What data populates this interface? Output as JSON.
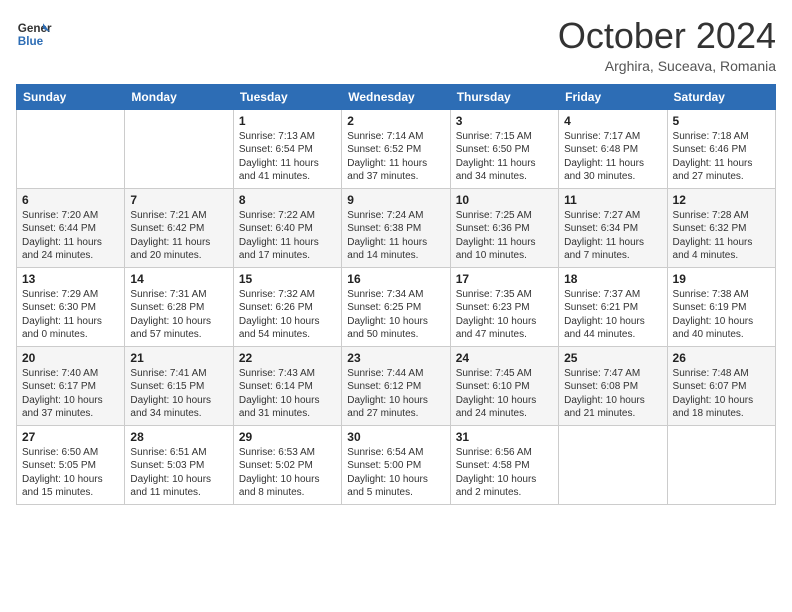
{
  "header": {
    "logo_line1": "General",
    "logo_line2": "Blue",
    "month": "October 2024",
    "location": "Arghira, Suceava, Romania"
  },
  "weekdays": [
    "Sunday",
    "Monday",
    "Tuesday",
    "Wednesday",
    "Thursday",
    "Friday",
    "Saturday"
  ],
  "weeks": [
    [
      {
        "day": "",
        "sunrise": "",
        "sunset": "",
        "daylight": ""
      },
      {
        "day": "",
        "sunrise": "",
        "sunset": "",
        "daylight": ""
      },
      {
        "day": "1",
        "sunrise": "Sunrise: 7:13 AM",
        "sunset": "Sunset: 6:54 PM",
        "daylight": "Daylight: 11 hours and 41 minutes."
      },
      {
        "day": "2",
        "sunrise": "Sunrise: 7:14 AM",
        "sunset": "Sunset: 6:52 PM",
        "daylight": "Daylight: 11 hours and 37 minutes."
      },
      {
        "day": "3",
        "sunrise": "Sunrise: 7:15 AM",
        "sunset": "Sunset: 6:50 PM",
        "daylight": "Daylight: 11 hours and 34 minutes."
      },
      {
        "day": "4",
        "sunrise": "Sunrise: 7:17 AM",
        "sunset": "Sunset: 6:48 PM",
        "daylight": "Daylight: 11 hours and 30 minutes."
      },
      {
        "day": "5",
        "sunrise": "Sunrise: 7:18 AM",
        "sunset": "Sunset: 6:46 PM",
        "daylight": "Daylight: 11 hours and 27 minutes."
      }
    ],
    [
      {
        "day": "6",
        "sunrise": "Sunrise: 7:20 AM",
        "sunset": "Sunset: 6:44 PM",
        "daylight": "Daylight: 11 hours and 24 minutes."
      },
      {
        "day": "7",
        "sunrise": "Sunrise: 7:21 AM",
        "sunset": "Sunset: 6:42 PM",
        "daylight": "Daylight: 11 hours and 20 minutes."
      },
      {
        "day": "8",
        "sunrise": "Sunrise: 7:22 AM",
        "sunset": "Sunset: 6:40 PM",
        "daylight": "Daylight: 11 hours and 17 minutes."
      },
      {
        "day": "9",
        "sunrise": "Sunrise: 7:24 AM",
        "sunset": "Sunset: 6:38 PM",
        "daylight": "Daylight: 11 hours and 14 minutes."
      },
      {
        "day": "10",
        "sunrise": "Sunrise: 7:25 AM",
        "sunset": "Sunset: 6:36 PM",
        "daylight": "Daylight: 11 hours and 10 minutes."
      },
      {
        "day": "11",
        "sunrise": "Sunrise: 7:27 AM",
        "sunset": "Sunset: 6:34 PM",
        "daylight": "Daylight: 11 hours and 7 minutes."
      },
      {
        "day": "12",
        "sunrise": "Sunrise: 7:28 AM",
        "sunset": "Sunset: 6:32 PM",
        "daylight": "Daylight: 11 hours and 4 minutes."
      }
    ],
    [
      {
        "day": "13",
        "sunrise": "Sunrise: 7:29 AM",
        "sunset": "Sunset: 6:30 PM",
        "daylight": "Daylight: 11 hours and 0 minutes."
      },
      {
        "day": "14",
        "sunrise": "Sunrise: 7:31 AM",
        "sunset": "Sunset: 6:28 PM",
        "daylight": "Daylight: 10 hours and 57 minutes."
      },
      {
        "day": "15",
        "sunrise": "Sunrise: 7:32 AM",
        "sunset": "Sunset: 6:26 PM",
        "daylight": "Daylight: 10 hours and 54 minutes."
      },
      {
        "day": "16",
        "sunrise": "Sunrise: 7:34 AM",
        "sunset": "Sunset: 6:25 PM",
        "daylight": "Daylight: 10 hours and 50 minutes."
      },
      {
        "day": "17",
        "sunrise": "Sunrise: 7:35 AM",
        "sunset": "Sunset: 6:23 PM",
        "daylight": "Daylight: 10 hours and 47 minutes."
      },
      {
        "day": "18",
        "sunrise": "Sunrise: 7:37 AM",
        "sunset": "Sunset: 6:21 PM",
        "daylight": "Daylight: 10 hours and 44 minutes."
      },
      {
        "day": "19",
        "sunrise": "Sunrise: 7:38 AM",
        "sunset": "Sunset: 6:19 PM",
        "daylight": "Daylight: 10 hours and 40 minutes."
      }
    ],
    [
      {
        "day": "20",
        "sunrise": "Sunrise: 7:40 AM",
        "sunset": "Sunset: 6:17 PM",
        "daylight": "Daylight: 10 hours and 37 minutes."
      },
      {
        "day": "21",
        "sunrise": "Sunrise: 7:41 AM",
        "sunset": "Sunset: 6:15 PM",
        "daylight": "Daylight: 10 hours and 34 minutes."
      },
      {
        "day": "22",
        "sunrise": "Sunrise: 7:43 AM",
        "sunset": "Sunset: 6:14 PM",
        "daylight": "Daylight: 10 hours and 31 minutes."
      },
      {
        "day": "23",
        "sunrise": "Sunrise: 7:44 AM",
        "sunset": "Sunset: 6:12 PM",
        "daylight": "Daylight: 10 hours and 27 minutes."
      },
      {
        "day": "24",
        "sunrise": "Sunrise: 7:45 AM",
        "sunset": "Sunset: 6:10 PM",
        "daylight": "Daylight: 10 hours and 24 minutes."
      },
      {
        "day": "25",
        "sunrise": "Sunrise: 7:47 AM",
        "sunset": "Sunset: 6:08 PM",
        "daylight": "Daylight: 10 hours and 21 minutes."
      },
      {
        "day": "26",
        "sunrise": "Sunrise: 7:48 AM",
        "sunset": "Sunset: 6:07 PM",
        "daylight": "Daylight: 10 hours and 18 minutes."
      }
    ],
    [
      {
        "day": "27",
        "sunrise": "Sunrise: 6:50 AM",
        "sunset": "Sunset: 5:05 PM",
        "daylight": "Daylight: 10 hours and 15 minutes."
      },
      {
        "day": "28",
        "sunrise": "Sunrise: 6:51 AM",
        "sunset": "Sunset: 5:03 PM",
        "daylight": "Daylight: 10 hours and 11 minutes."
      },
      {
        "day": "29",
        "sunrise": "Sunrise: 6:53 AM",
        "sunset": "Sunset: 5:02 PM",
        "daylight": "Daylight: 10 hours and 8 minutes."
      },
      {
        "day": "30",
        "sunrise": "Sunrise: 6:54 AM",
        "sunset": "Sunset: 5:00 PM",
        "daylight": "Daylight: 10 hours and 5 minutes."
      },
      {
        "day": "31",
        "sunrise": "Sunrise: 6:56 AM",
        "sunset": "Sunset: 4:58 PM",
        "daylight": "Daylight: 10 hours and 2 minutes."
      },
      {
        "day": "",
        "sunrise": "",
        "sunset": "",
        "daylight": ""
      },
      {
        "day": "",
        "sunrise": "",
        "sunset": "",
        "daylight": ""
      }
    ]
  ]
}
